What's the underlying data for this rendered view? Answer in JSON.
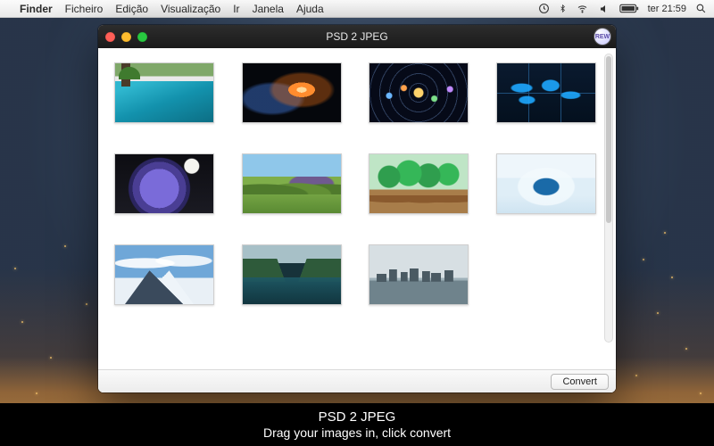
{
  "menubar": {
    "app": "Finder",
    "items": [
      "Ficheiro",
      "Edição",
      "Visualização",
      "Ir",
      "Janela",
      "Ajuda"
    ],
    "clock": "ter 21:59"
  },
  "window": {
    "title": "PSD 2 JPEG",
    "badge": "REW",
    "convert_label": "Convert",
    "thumbs": [
      {
        "name": "pool"
      },
      {
        "name": "nebula"
      },
      {
        "name": "solar"
      },
      {
        "name": "worldmap"
      },
      {
        "name": "rose"
      },
      {
        "name": "hills"
      },
      {
        "name": "trees"
      },
      {
        "name": "ice"
      },
      {
        "name": "peak"
      },
      {
        "name": "lake"
      },
      {
        "name": "skyline"
      }
    ]
  },
  "caption": {
    "title": "PSD 2 JPEG",
    "subtitle": "Drag your images in, click convert"
  }
}
